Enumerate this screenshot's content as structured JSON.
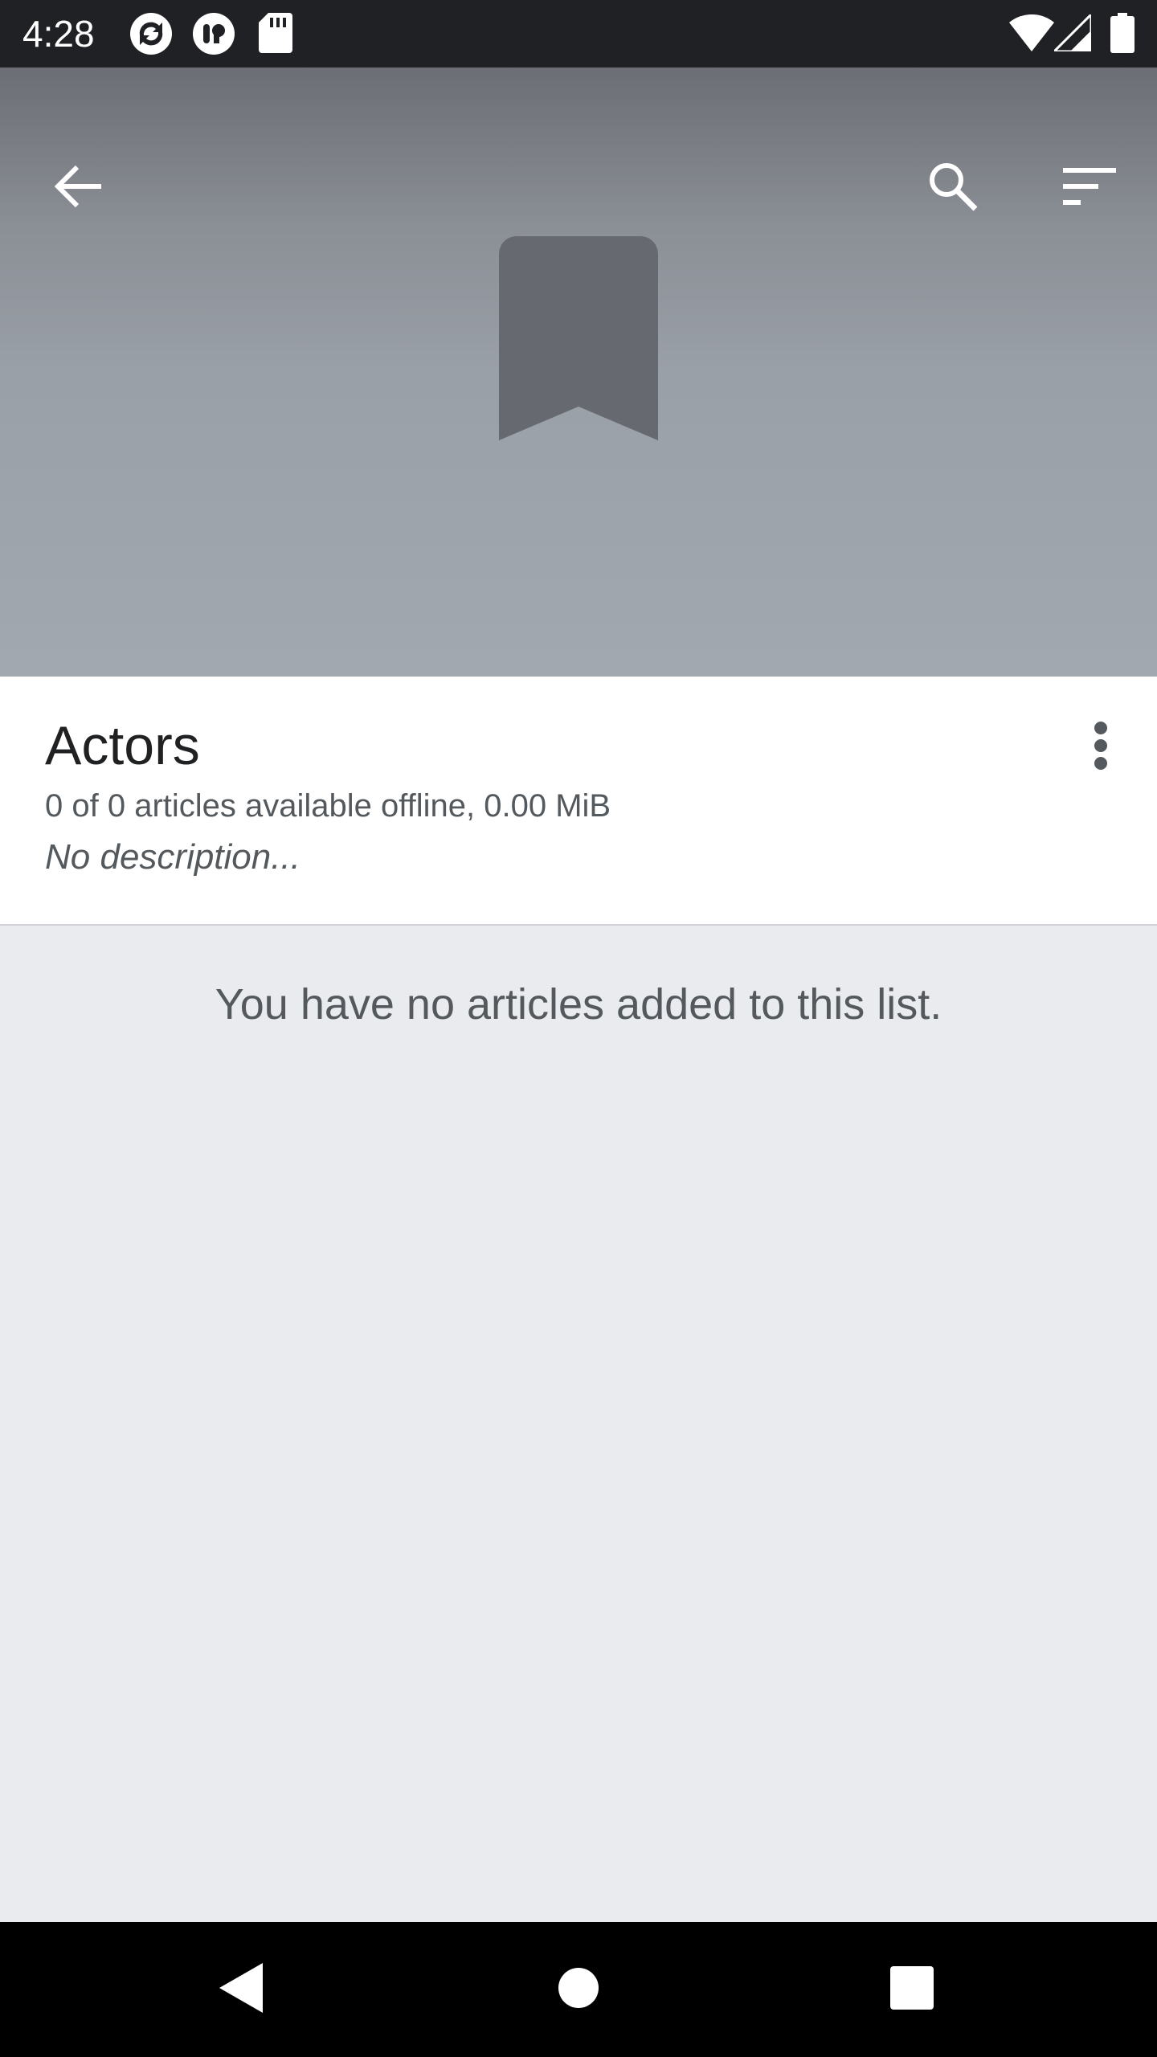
{
  "status_bar": {
    "time": "4:28",
    "left_icons": [
      "sync-app-icon",
      "podcast-app-icon",
      "sd-card-icon"
    ],
    "right_icons": [
      "wifi-icon",
      "cell-signal-icon",
      "battery-icon"
    ]
  },
  "toolbar": {
    "back_icon": "arrow-left-icon",
    "search_icon": "search-icon",
    "sort_icon": "sort-icon"
  },
  "hero": {
    "icon": "bookmark-icon"
  },
  "list": {
    "title": "Actors",
    "stats": "0 of 0 articles available offline, 0.00 MiB",
    "description": "No description...",
    "overflow_icon": "more-vert-icon"
  },
  "empty_state": {
    "message": "You have no articles added to this list."
  },
  "nav_bar": {
    "back_icon": "nav-back-icon",
    "home_icon": "nav-home-icon",
    "recents_icon": "nav-recents-icon"
  },
  "colors": {
    "status_bar": "#202124",
    "hero_top": "#6b6e74",
    "hero_bottom": "#a2a8b0",
    "bookmark": "#66696f",
    "card": "#ffffff",
    "page_bg": "#eaebef",
    "nav_bar": "#000000"
  }
}
